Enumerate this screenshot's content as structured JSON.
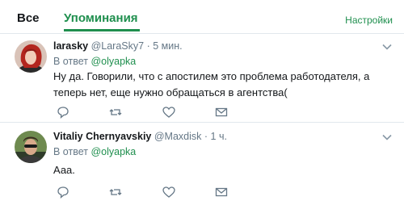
{
  "tabs": {
    "all": "Все",
    "mentions": "Упоминания"
  },
  "settings_label": "Настройки",
  "tweets": [
    {
      "name": "larasky",
      "handle": "@LaraSky7",
      "time": "· 5 мин.",
      "reply_prefix": "В ответ",
      "reply_to": "@olyapka",
      "text": "Ну да. Говорили, что с апостилем это проблема работодателя, а теперь нет, еще нужно обращаться в агентства("
    },
    {
      "name": "Vitaliy Chernyavskiy",
      "handle": "@Maxdisk",
      "time": "· 1 ч.",
      "reply_prefix": "В ответ",
      "reply_to": "@olyapka",
      "text": "Ааа."
    }
  ],
  "icons": {
    "reply": "speech-bubble-icon",
    "retweet": "retweet-icon",
    "like": "heart-icon",
    "message": "envelope-icon",
    "menu": "chevron-down-icon"
  },
  "colors": {
    "accent": "#1f8f4e",
    "muted": "#657786",
    "divider": "#e1e8ed"
  }
}
